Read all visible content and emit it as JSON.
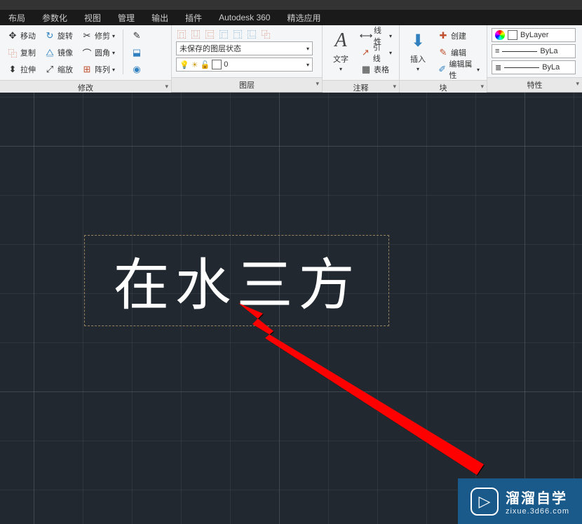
{
  "menubar": {
    "items": [
      "布局",
      "参数化",
      "视图",
      "管理",
      "输出",
      "插件",
      "Autodesk 360",
      "精选应用"
    ]
  },
  "ribbon": {
    "modify": {
      "title": "修改",
      "move": "移动",
      "rotate": "旋转",
      "trim": "修剪",
      "copy": "复制",
      "mirror": "镜像",
      "fillet": "圆角",
      "stretch": "拉伸",
      "scale": "缩放",
      "array": "阵列"
    },
    "layers": {
      "title": "图层",
      "state": "未保存的图层状态",
      "zero": "0"
    },
    "annotation": {
      "title": "注释",
      "text": "文字",
      "linear": "线性",
      "leader": "引线",
      "table": "表格"
    },
    "block": {
      "title": "块",
      "insert": "插入",
      "create": "创建",
      "edit": "编辑",
      "editattr": "编辑属性"
    },
    "properties": {
      "title": "特性",
      "bylayer": "ByLayer",
      "bylayer2": "ByLa",
      "bylayer3": "ByLa"
    }
  },
  "canvas": {
    "text": "在水三方"
  },
  "watermark": {
    "title": "溜溜自学",
    "sub": "zixue.3d66.com"
  }
}
